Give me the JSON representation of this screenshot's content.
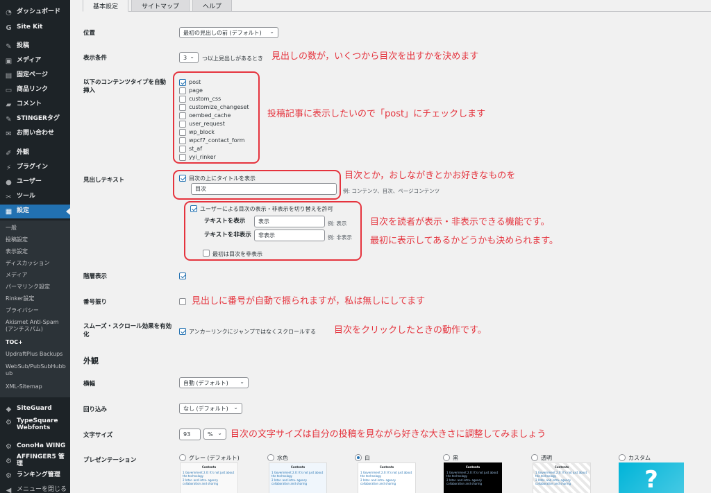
{
  "sidebar": {
    "top": [
      {
        "label": "ダッシュボード",
        "icon": "gauge-icon"
      },
      {
        "label": "Site Kit",
        "icon": "sitekit-logo-icon"
      },
      {
        "label": "投稿",
        "icon": "pin-icon"
      },
      {
        "label": "メディア",
        "icon": "media-icon"
      },
      {
        "label": "固定ページ",
        "icon": "page-icon"
      },
      {
        "label": "商品リンク",
        "icon": "link-icon"
      },
      {
        "label": "コメント",
        "icon": "comment-icon"
      },
      {
        "label": "STINGERタグ",
        "icon": "pin-icon"
      },
      {
        "label": "お問い合わせ",
        "icon": "mail-icon"
      },
      {
        "label": "外観",
        "icon": "brush-icon"
      },
      {
        "label": "プラグイン",
        "icon": "plug-icon"
      },
      {
        "label": "ユーザー",
        "icon": "user-icon"
      },
      {
        "label": "ツール",
        "icon": "wrench-icon"
      },
      {
        "label": "設定",
        "icon": "settings-icon"
      }
    ],
    "submenu": [
      "一般",
      "投稿設定",
      "表示設定",
      "ディスカッション",
      "メディア",
      "パーマリンク設定",
      "Rinker設定",
      "プライバシー",
      "Akismet Anti-Spam (アンチスパム)",
      "TOC+",
      "UpdraftPlus Backups",
      "WebSub/PubSubHubbub",
      "XML-Sitemap"
    ],
    "bottom": [
      {
        "label": "SiteGuard",
        "icon": "shield-icon"
      },
      {
        "label": "TypeSquare Webfonts",
        "icon": "gear-icon"
      },
      {
        "label": "ConoHa WING",
        "icon": "gear-icon"
      },
      {
        "label": "AFFINGER5 管理",
        "icon": "gear-icon"
      },
      {
        "label": "ランキング管理",
        "icon": "gear-icon"
      },
      {
        "label": "メニューを閉じる",
        "icon": "collapse-icon"
      }
    ]
  },
  "tabs": [
    "基本設定",
    "サイトマップ",
    "ヘルプ"
  ],
  "settings": {
    "position": {
      "label": "位置",
      "value": "最初の見出しの前 (デフォルト)"
    },
    "condition": {
      "label": "表示条件",
      "value": "3",
      "suffix": "つ以上見出しがあるとき"
    },
    "auto_insert": {
      "label": "以下のコンテンツタイプを自動挿入",
      "types": [
        "post",
        "page",
        "custom_css",
        "customize_changeset",
        "oembed_cache",
        "user_request",
        "wp_block",
        "wpcf7_contact_form",
        "st_af",
        "yyi_rinker"
      ]
    },
    "heading": {
      "label": "見出しテキスト",
      "show_title": "目次の上にタイトルを表示",
      "title_value": "目次",
      "title_hint": "例: コンテンツ、目次、ページコンテンツ",
      "toggle_label": "ユーザーによる目次の表示・非表示を切り替えを許可",
      "show_label": "テキストを表示",
      "show_value": "表示",
      "show_hint": "例: 表示",
      "hide_label": "テキストを非表示",
      "hide_value": "非表示",
      "hide_hint": "例: 非表示",
      "initial_hide": "最初は目次を非表示"
    },
    "hierarchy": {
      "label": "階層表示"
    },
    "numbering": {
      "label": "番号振り"
    },
    "smooth": {
      "label": "スムーズ・スクロール効果を有効化",
      "text": "アンカーリンクにジャンプではなくスクロールする"
    },
    "appearance_heading": "外観",
    "width": {
      "label": "横幅",
      "value": "自動 (デフォルト)"
    },
    "wrap": {
      "label": "回り込み",
      "value": "なし (デフォルト)"
    },
    "font_size": {
      "label": "文字サイズ",
      "value": "93",
      "unit": "%"
    },
    "presentation": {
      "label": "プレゼンテーション",
      "options": [
        "グレー (デフォルト)",
        "水色",
        "白",
        "黒",
        "透明",
        "カスタム"
      ],
      "selected": "白"
    }
  },
  "preview": {
    "title": "Contents",
    "lines": [
      "1 Government 2.0: It's not just about the technology",
      "2 Inter- and intra- agency collaboration and sharing"
    ],
    "custom_mark": "?"
  },
  "annotations": {
    "a1": "見出しの数が，いくつから目次を出すかを決めます",
    "a2": "投稿記事に表示したいので「post」にチェックします",
    "a3": "目次とか，おしながきとかお好きなものを",
    "a4": "目次を読者が表示・非表示できる機能です。",
    "a5": "最初に表示してあるかどうかも決められます。",
    "a6": "見出しに番号が自動で振られますが，私は無しにしてます",
    "a7": "目次をクリックしたときの動作です。",
    "a8": "目次の文字サイズは自分の投稿を見ながら好きな大きさに調整してみましょう"
  }
}
